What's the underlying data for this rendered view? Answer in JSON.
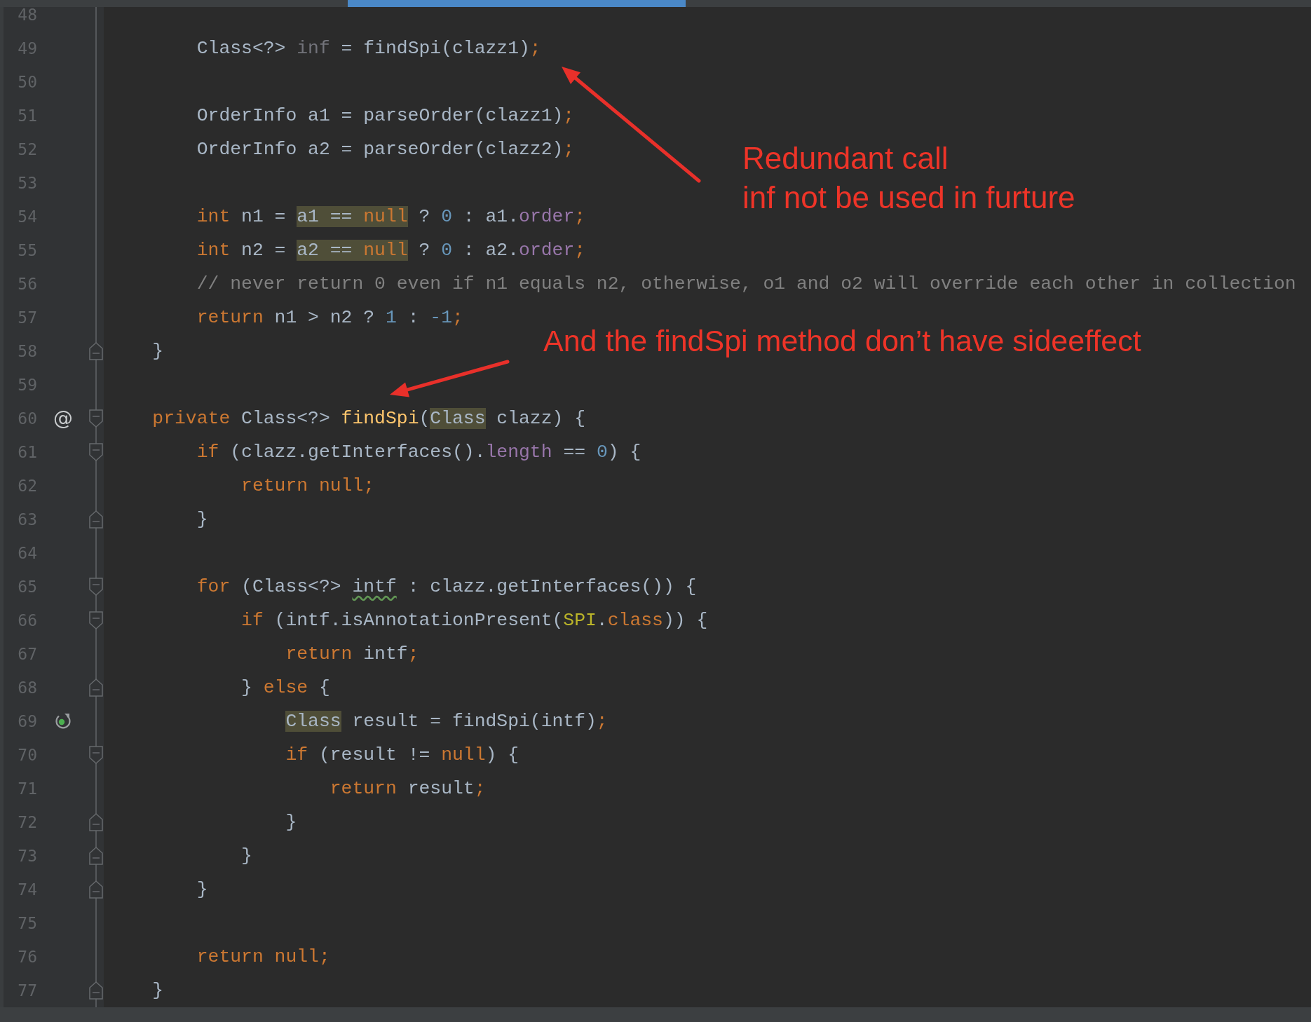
{
  "editor": {
    "lines": [
      {
        "number": "48"
      },
      {
        "number": "49",
        "tokens": [
          {
            "text": "        Class<?> ",
            "kind": "plain"
          },
          {
            "text": "inf",
            "kind": "unused"
          },
          {
            "text": " = findSpi(clazz1)",
            "kind": "plain"
          },
          {
            "text": ";",
            "kind": "keyword"
          }
        ]
      },
      {
        "number": "50"
      },
      {
        "number": "51",
        "tokens": [
          {
            "text": "        OrderInfo a1 = parseOrder(clazz1)",
            "kind": "plain"
          },
          {
            "text": ";",
            "kind": "keyword"
          }
        ]
      },
      {
        "number": "52",
        "tokens": [
          {
            "text": "        OrderInfo a2 = parseOrder(clazz2)",
            "kind": "plain"
          },
          {
            "text": ";",
            "kind": "keyword"
          }
        ]
      },
      {
        "number": "53"
      },
      {
        "number": "54",
        "tokens": [
          {
            "text": "        int",
            "kind": "keyword"
          },
          {
            "text": " n1 = ",
            "kind": "plain"
          },
          {
            "text": "a1 == ",
            "kind": "plain",
            "highlighted": true
          },
          {
            "text": "null",
            "kind": "keyword",
            "highlighted": true
          },
          {
            "text": " ? ",
            "kind": "plain"
          },
          {
            "text": "0",
            "kind": "number"
          },
          {
            "text": " : a1.",
            "kind": "plain"
          },
          {
            "text": "order",
            "kind": "field"
          },
          {
            "text": ";",
            "kind": "keyword"
          }
        ]
      },
      {
        "number": "55",
        "tokens": [
          {
            "text": "        int",
            "kind": "keyword"
          },
          {
            "text": " n2 = ",
            "kind": "plain"
          },
          {
            "text": "a2 == ",
            "kind": "plain",
            "highlighted": true
          },
          {
            "text": "null",
            "kind": "keyword",
            "highlighted": true
          },
          {
            "text": " ? ",
            "kind": "plain"
          },
          {
            "text": "0",
            "kind": "number"
          },
          {
            "text": " : a2.",
            "kind": "plain"
          },
          {
            "text": "order",
            "kind": "field"
          },
          {
            "text": ";",
            "kind": "keyword"
          }
        ]
      },
      {
        "number": "56",
        "tokens": [
          {
            "text": "        // never return 0 even if n1 equals n2, otherwise, o1 and o2 will override each other in collection",
            "kind": "comment"
          }
        ]
      },
      {
        "number": "57",
        "tokens": [
          {
            "text": "        return",
            "kind": "keyword"
          },
          {
            "text": " n1 > n2 ? ",
            "kind": "plain"
          },
          {
            "text": "1",
            "kind": "number"
          },
          {
            "text": " : ",
            "kind": "plain"
          },
          {
            "text": "-1",
            "kind": "number"
          },
          {
            "text": ";",
            "kind": "keyword"
          }
        ]
      },
      {
        "number": "58",
        "fold": {
          "kind": "end"
        },
        "tokens": [
          {
            "text": "    }",
            "kind": "plain"
          }
        ]
      },
      {
        "number": "59"
      },
      {
        "number": "60",
        "gutter_mark": "@",
        "fold": {
          "kind": "start"
        },
        "tokens": [
          {
            "text": "    private",
            "kind": "keyword"
          },
          {
            "text": " Class<?> ",
            "kind": "plain"
          },
          {
            "text": "findSpi",
            "kind": "declaration"
          },
          {
            "text": "(",
            "kind": "plain"
          },
          {
            "text": "Class",
            "kind": "plain",
            "highlighted": true
          },
          {
            "text": " clazz) {",
            "kind": "plain"
          }
        ]
      },
      {
        "number": "61",
        "fold": {
          "kind": "start"
        },
        "tokens": [
          {
            "text": "        if",
            "kind": "keyword"
          },
          {
            "text": " (clazz.getInterfaces().",
            "kind": "plain"
          },
          {
            "text": "length",
            "kind": "field"
          },
          {
            "text": " == ",
            "kind": "plain"
          },
          {
            "text": "0",
            "kind": "number"
          },
          {
            "text": ") {",
            "kind": "plain"
          }
        ]
      },
      {
        "number": "62",
        "tokens": [
          {
            "text": "            return null;",
            "kind": "keyword"
          }
        ]
      },
      {
        "number": "63",
        "fold": {
          "kind": "end"
        },
        "tokens": [
          {
            "text": "        }",
            "kind": "plain"
          }
        ]
      },
      {
        "number": "64"
      },
      {
        "number": "65",
        "fold": {
          "kind": "start"
        },
        "tokens": [
          {
            "text": "        for",
            "kind": "keyword"
          },
          {
            "text": " (Class<?> ",
            "kind": "plain"
          },
          {
            "text": "intf",
            "kind": "plain",
            "warning": true
          },
          {
            "text": " : clazz.getInterfaces()) {",
            "kind": "plain"
          }
        ]
      },
      {
        "number": "66",
        "fold": {
          "kind": "start"
        },
        "tokens": [
          {
            "text": "            if",
            "kind": "keyword"
          },
          {
            "text": " (intf.isAnnotationPresent(",
            "kind": "plain"
          },
          {
            "text": "SPI",
            "kind": "annotation"
          },
          {
            "text": ".",
            "kind": "plain"
          },
          {
            "text": "class",
            "kind": "keyword"
          },
          {
            "text": ")) {",
            "kind": "plain"
          }
        ]
      },
      {
        "number": "67",
        "tokens": [
          {
            "text": "                return",
            "kind": "keyword"
          },
          {
            "text": " intf",
            "kind": "plain"
          },
          {
            "text": ";",
            "kind": "keyword"
          }
        ]
      },
      {
        "number": "68",
        "fold": {
          "kind": "end"
        },
        "tokens": [
          {
            "text": "            }",
            "kind": "plain"
          },
          {
            "text": " else",
            "kind": "keyword"
          },
          {
            "text": " {",
            "kind": "plain"
          }
        ]
      },
      {
        "number": "69",
        "gutter_icon": {
          "kind": "recursion"
        },
        "tokens": [
          {
            "text": "                Class",
            "kind": "plain",
            "highlighted": true
          },
          {
            "text": " result = findSpi(intf)",
            "kind": "plain"
          },
          {
            "text": ";",
            "kind": "keyword"
          }
        ]
      },
      {
        "number": "70",
        "fold": {
          "kind": "start"
        },
        "tokens": [
          {
            "text": "                if",
            "kind": "keyword"
          },
          {
            "text": " (result != ",
            "kind": "plain"
          },
          {
            "text": "null",
            "kind": "keyword"
          },
          {
            "text": ") {",
            "kind": "plain"
          }
        ]
      },
      {
        "number": "71",
        "tokens": [
          {
            "text": "                    return",
            "kind": "keyword"
          },
          {
            "text": " result",
            "kind": "plain"
          },
          {
            "text": ";",
            "kind": "keyword"
          }
        ]
      },
      {
        "number": "72",
        "fold": {
          "kind": "end"
        },
        "tokens": [
          {
            "text": "                }",
            "kind": "plain"
          }
        ]
      },
      {
        "number": "73",
        "fold": {
          "kind": "end"
        },
        "tokens": [
          {
            "text": "            }",
            "kind": "plain"
          }
        ]
      },
      {
        "number": "74",
        "fold": {
          "kind": "end"
        },
        "tokens": [
          {
            "text": "        }",
            "kind": "plain"
          }
        ]
      },
      {
        "number": "75"
      },
      {
        "number": "76",
        "tokens": [
          {
            "text": "        return null;",
            "kind": "keyword"
          }
        ]
      },
      {
        "number": "77",
        "fold": {
          "kind": "end"
        },
        "tokens": [
          {
            "text": "    }",
            "kind": "plain"
          }
        ]
      }
    ]
  },
  "annotations": [
    {
      "lines": [
        "Redundant call",
        "inf not be used in furture"
      ]
    },
    {
      "lines": [
        "And the findSpi method don’t have sideeffect"
      ]
    }
  ]
}
